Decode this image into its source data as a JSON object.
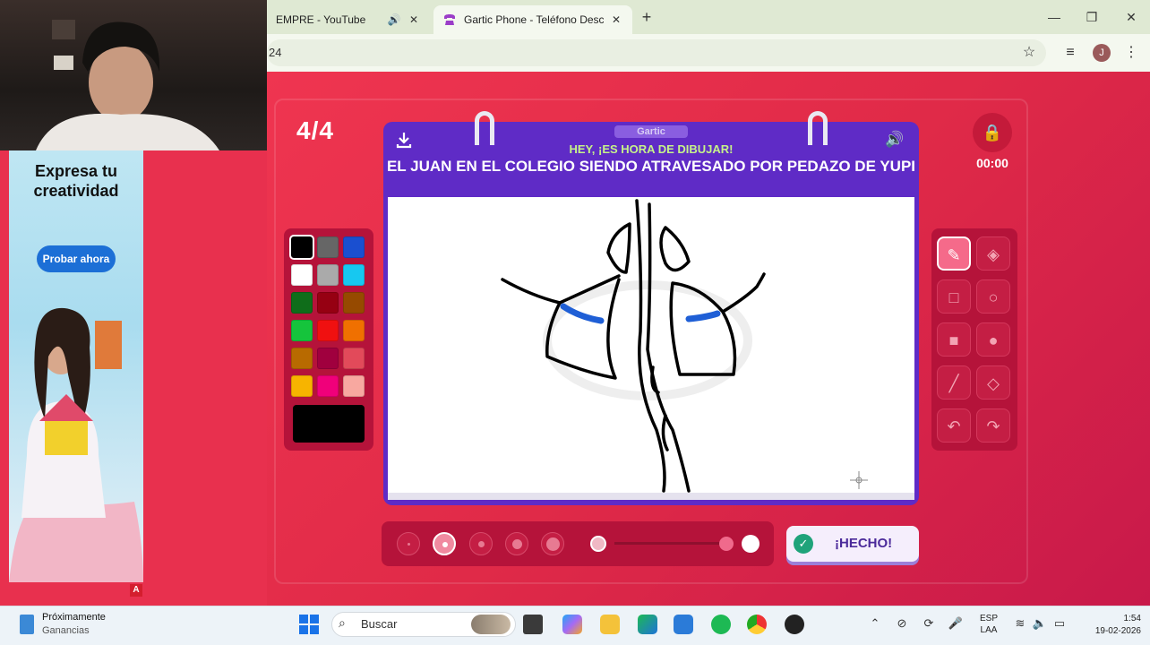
{
  "browser": {
    "tabs": [
      {
        "label": "EMPRE - YouTube",
        "active": false
      },
      {
        "label": "Gartic Phone - Teléfono Descor",
        "active": true
      }
    ],
    "address": "24"
  },
  "ad": {
    "title": "Expresa tu creatividad",
    "button": "Probar ahora",
    "badge": "A"
  },
  "game": {
    "round": "4/4",
    "logo_tag": "Gartic",
    "hint": "HEY, ¡ES HORA DE DIBUJAR!",
    "prompt": "EL JUAN EN EL COLEGIO SIENDO ATRAVESADO POR PEDAZO DE YUPI",
    "timer": "00:00",
    "done_label": "¡HECHO!",
    "palette": [
      "#000000",
      "#666666",
      "#1a4fd0",
      "#ffffff",
      "#aaaaaa",
      "#17c8f0",
      "#0f6d1a",
      "#960012",
      "#964a00",
      "#15c43c",
      "#f01010",
      "#f07000",
      "#b86a00",
      "#a0003e",
      "#e24a5a",
      "#f7b400",
      "#f0007a",
      "#f8a8a0"
    ],
    "selected_color": "#000000"
  },
  "taskbar": {
    "weather_title": "Próximamente",
    "weather_sub": "Ganancias",
    "search_placeholder": "Buscar",
    "lang_1": "ESP",
    "lang_2": "LAA",
    "time": "1:54",
    "date": "19-02-2026"
  }
}
